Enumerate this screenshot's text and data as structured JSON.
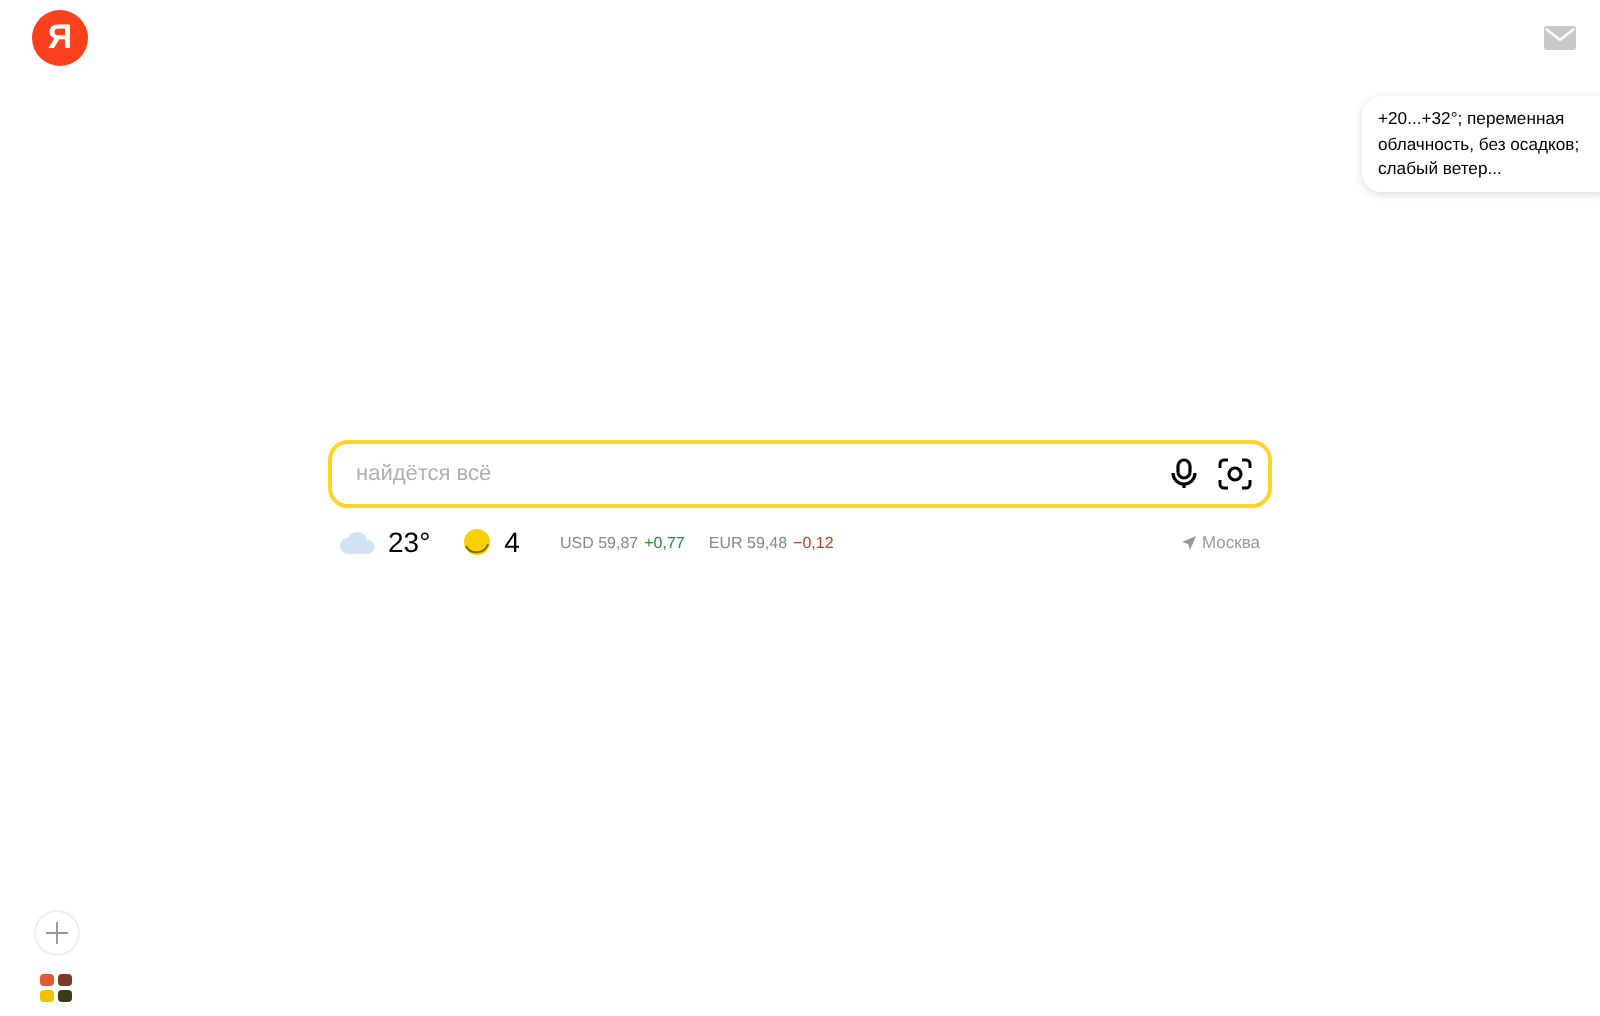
{
  "logo": {
    "letter": "Я"
  },
  "weather_popup": {
    "text": "+20...+32°; переменная облачность, без осадков; слабый ветер..."
  },
  "search": {
    "placeholder": "найдётся всё"
  },
  "informers": {
    "weather": "23°",
    "traffic": "4",
    "rates": [
      {
        "name": "USD",
        "value": "59,87",
        "change": "+0,77",
        "color": "#2a8a3a"
      },
      {
        "name": "EUR",
        "value": "59,48",
        "change": "−0,12",
        "color": "#c83a2a"
      }
    ],
    "city": "Москва"
  }
}
